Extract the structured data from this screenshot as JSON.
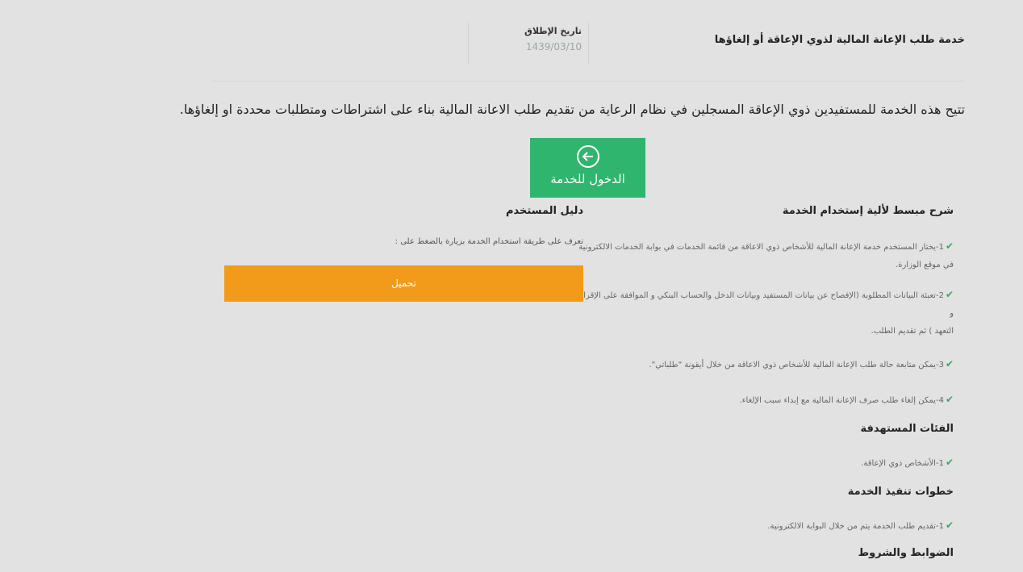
{
  "header": {
    "service_title": "خدمة طلب الإعانة المالية لذوي الإعاقة أو إلغاؤها",
    "launch_label": "تاريخ الإطلاق",
    "launch_date": "1439/03/10"
  },
  "intro": "تتيح هذه الخدمة للمستفيدين ذوي الإعاقة المسجلين في نظام الرعاية من تقديم طلب الاعانة المالية بناء على اشتراطات ومتطلبات محددة او إلغاؤها.",
  "enter_button": {
    "label": "الدخول للخدمة",
    "icon": "arrow-left-circle-icon"
  },
  "explanation": {
    "heading": "شرح مبسط لألية إستخدام الخدمة",
    "items": [
      "1-يختار المستخدم خدمة الإعانة المالية للأشخاص ذوي الاعاقة من قائمة الخدمات في بوابة الخدمات الالكترونية",
      "في موقع الوزارة.",
      "2-تعبئة البيانات المطلوبة (الإفصاح عن بيانات المستفيد وبيانات الدخل والحساب البنكي و الموافقة على الإقرار و",
      "التعهد ) ثم تقديم الطلب.",
      "3-يمكن متابعة حالة طلب الإعانة المالية للأشخاص ذوي الاعاقة من خلال أيقونة \"طلباتي\".",
      "4-يمكن إلغاء طلب صرف الإعانة المالية مع إبداء سبب الإلغاء."
    ]
  },
  "target_groups": {
    "heading": "الفئات المستهدفة",
    "items": [
      "1-الأشخاص ذوي الإعاقة."
    ]
  },
  "steps": {
    "heading": "خطوات تنفيذ الخدمة",
    "items": [
      "1-تقديم طلب الخدمة يتم من خلال البوابة الالكترونية."
    ]
  },
  "terms": {
    "heading": "الضوابط والشروط"
  },
  "user_guide": {
    "heading": "دليل المستخدم",
    "text": "تعرف على طريقة استخدام الخدمة بزيارة بالضغط على :",
    "download_label": "تحميل"
  },
  "colors": {
    "background": "#e2e2e2",
    "enter_button": "#2fb56d",
    "download_button": "#f29a1a",
    "check": "#2eae5e"
  }
}
